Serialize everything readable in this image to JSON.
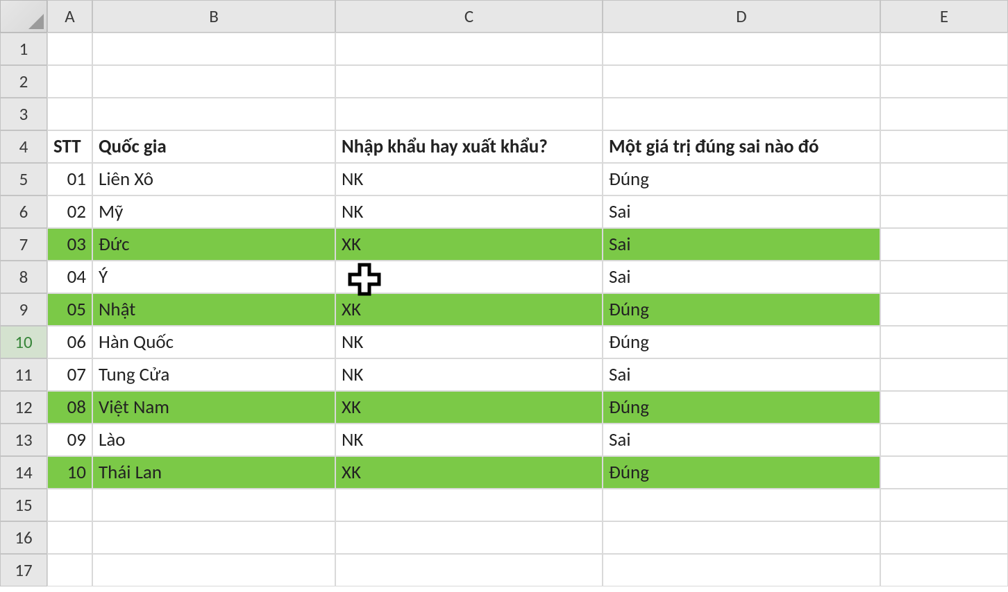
{
  "columns": [
    "A",
    "B",
    "C",
    "D",
    "E"
  ],
  "rowCount": 17,
  "activeRow": 10,
  "headers": {
    "A": "STT",
    "B": "Quốc gia",
    "C": "Nhập khẩu hay xuất khẩu?",
    "D": "Một giá trị đúng sai nào đó"
  },
  "data": [
    {
      "stt": "01",
      "country": "Liên Xô",
      "io": "NK",
      "flag": "Đúng",
      "hl": false
    },
    {
      "stt": "02",
      "country": "Mỹ",
      "io": "NK",
      "flag": "Sai",
      "hl": false
    },
    {
      "stt": "03",
      "country": "Đức",
      "io": "XK",
      "flag": "Sai",
      "hl": true
    },
    {
      "stt": "04",
      "country": "Ý",
      "io": "",
      "flag": "Sai",
      "hl": false
    },
    {
      "stt": "05",
      "country": "Nhật",
      "io": "XK",
      "flag": "Đúng",
      "hl": true
    },
    {
      "stt": "06",
      "country": "Hàn Quốc",
      "io": "NK",
      "flag": "Đúng",
      "hl": false
    },
    {
      "stt": "07",
      "country": "Tung Cửa",
      "io": "NK",
      "flag": "Sai",
      "hl": false
    },
    {
      "stt": "08",
      "country": "Việt Nam",
      "io": "XK",
      "flag": "Đúng",
      "hl": true
    },
    {
      "stt": "09",
      "country": "Lào",
      "io": "NK",
      "flag": "Sai",
      "hl": false
    },
    {
      "stt": "10",
      "country": "Thái Lan",
      "io": "XK",
      "flag": "Đúng",
      "hl": true
    }
  ],
  "colors": {
    "highlight": "#7bc947"
  }
}
